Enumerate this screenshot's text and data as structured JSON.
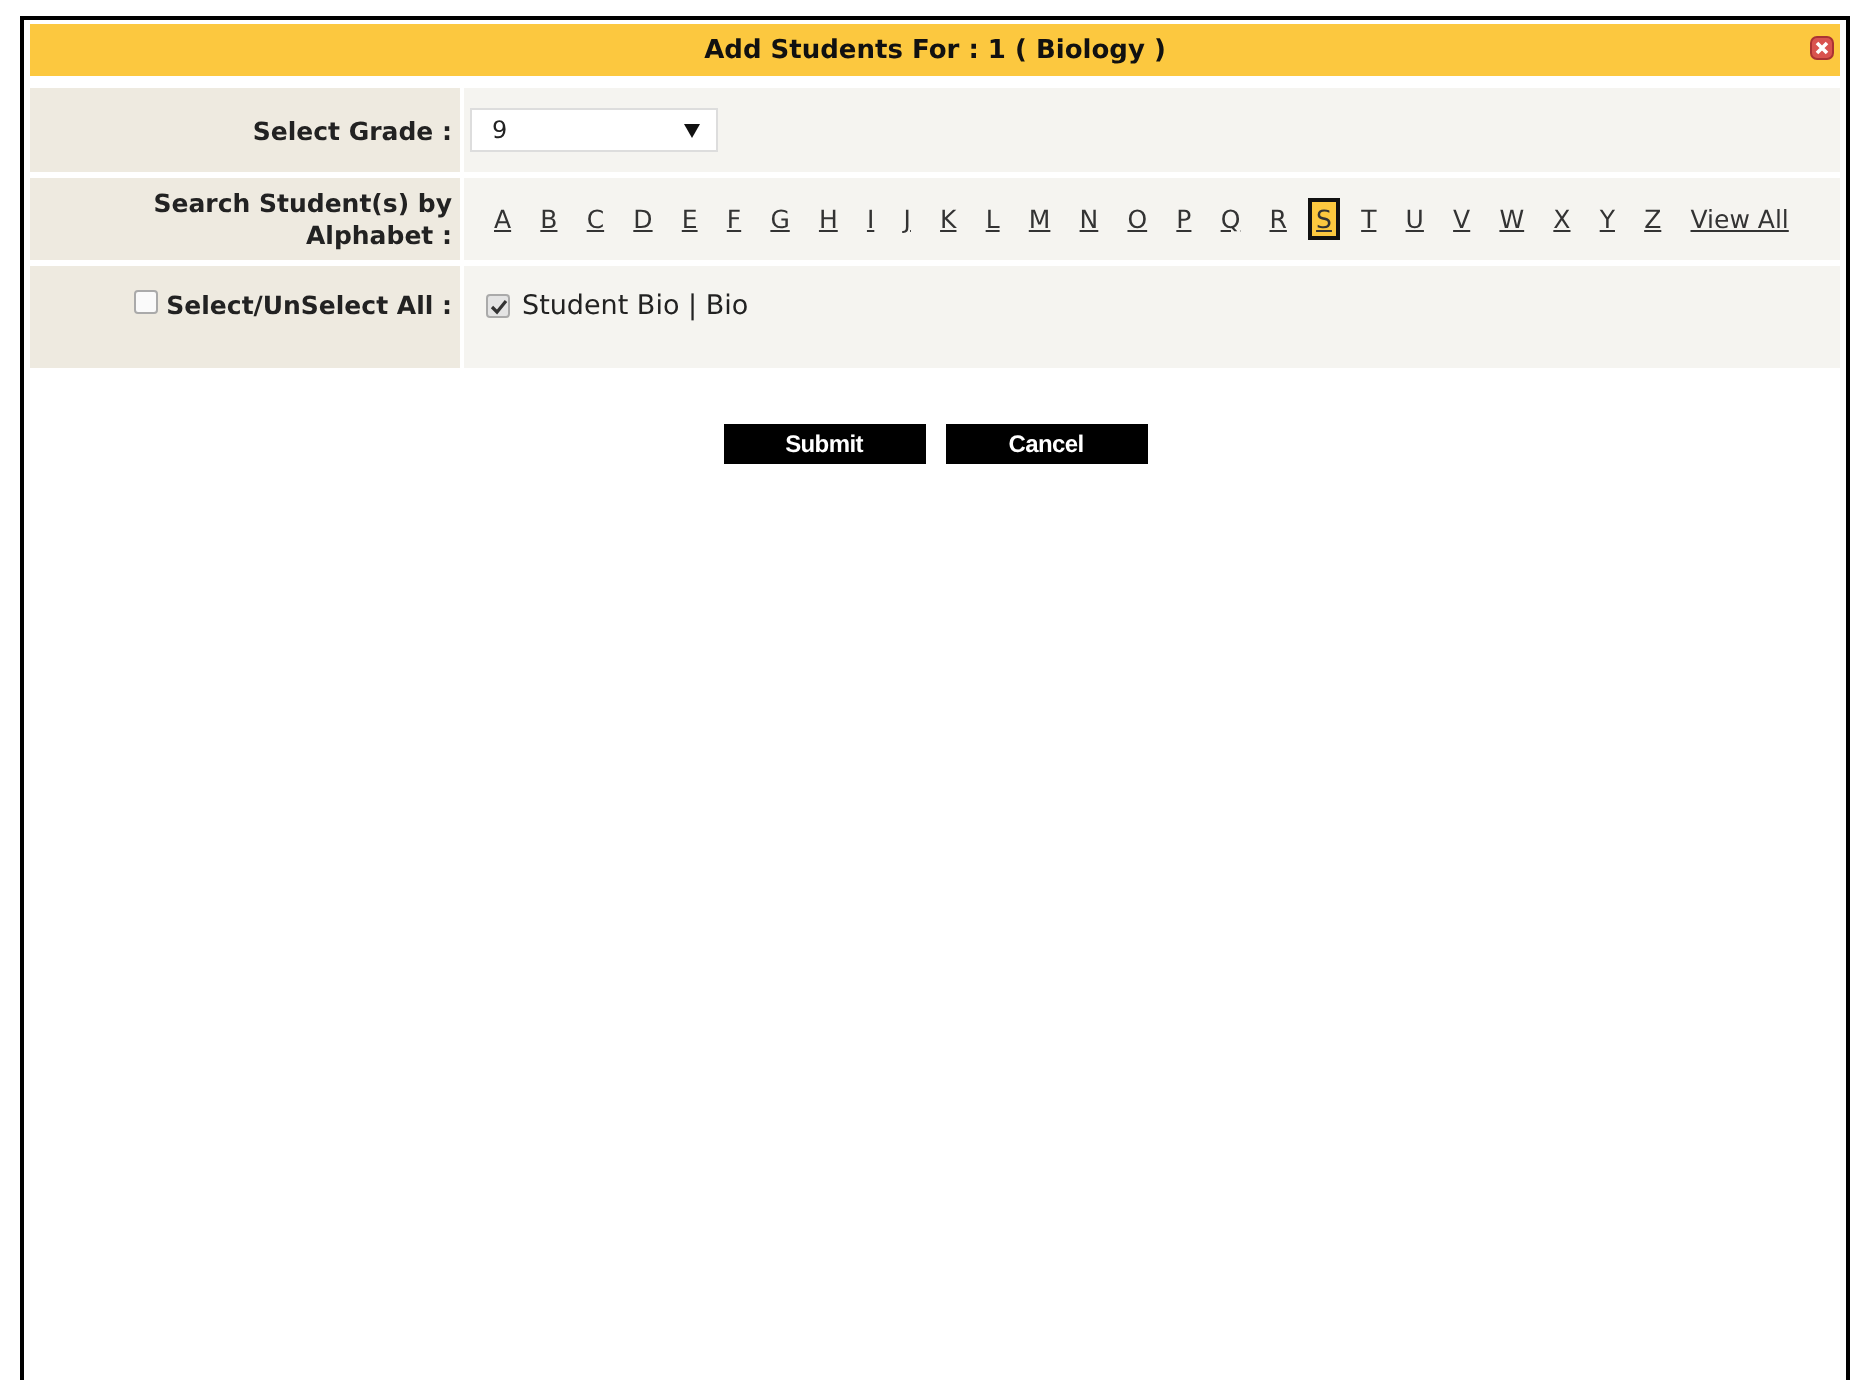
{
  "dialog": {
    "title": "Add Students For : 1 ( Biology )"
  },
  "grade": {
    "label": "Select Grade :",
    "value": "9"
  },
  "alphabet": {
    "label": "Search Student(s) by Alphabet :",
    "letters": [
      {
        "text": "A",
        "selected": false
      },
      {
        "text": "B",
        "selected": false
      },
      {
        "text": "C",
        "selected": false
      },
      {
        "text": "D",
        "selected": false
      },
      {
        "text": "E",
        "selected": false
      },
      {
        "text": "F",
        "selected": false
      },
      {
        "text": "G",
        "selected": false
      },
      {
        "text": "H",
        "selected": false
      },
      {
        "text": "I",
        "selected": false
      },
      {
        "text": "J",
        "selected": false
      },
      {
        "text": "K",
        "selected": false
      },
      {
        "text": "L",
        "selected": false
      },
      {
        "text": "M",
        "selected": false
      },
      {
        "text": "N",
        "selected": false
      },
      {
        "text": "O",
        "selected": false
      },
      {
        "text": "P",
        "selected": false
      },
      {
        "text": "Q",
        "selected": false
      },
      {
        "text": "R",
        "selected": false
      },
      {
        "text": "S",
        "selected": true
      },
      {
        "text": "T",
        "selected": false
      },
      {
        "text": "U",
        "selected": false
      },
      {
        "text": "V",
        "selected": false
      },
      {
        "text": "W",
        "selected": false
      },
      {
        "text": "X",
        "selected": false
      },
      {
        "text": "Y",
        "selected": false
      },
      {
        "text": "Z",
        "selected": false
      },
      {
        "text": "View All",
        "selected": false
      }
    ]
  },
  "select_all": {
    "label": "Select/UnSelect All :",
    "checked": false
  },
  "students": [
    {
      "label": "Student Bio | Bio",
      "checked": true
    }
  ],
  "buttons": [
    "Submit",
    "Cancel"
  ]
}
